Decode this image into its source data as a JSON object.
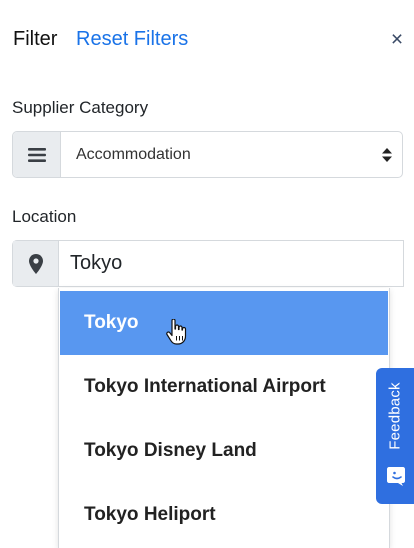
{
  "header": {
    "title": "Filter",
    "reset_label": "Reset Filters",
    "close_symbol": "×"
  },
  "supplier_category": {
    "label": "Supplier Category",
    "selected": "Accommodation",
    "addon_icon": "list-icon",
    "caret_icon": "sort-caret-icon"
  },
  "location": {
    "label": "Location",
    "value": "Tokyo",
    "addon_icon": "map-marker-icon"
  },
  "dropdown": {
    "items": [
      "Tokyo",
      "Tokyo International Airport",
      "Tokyo Disney Land",
      "Tokyo Heliport"
    ],
    "active_index": 0
  },
  "feedback": {
    "label": "Feedback",
    "icon": "chat-smile-icon"
  },
  "colors": {
    "accent": "#1a73e8",
    "active_item": "#5897f0",
    "feedback_tab": "#2f6fe0",
    "addon_bg": "#e9ecef"
  }
}
